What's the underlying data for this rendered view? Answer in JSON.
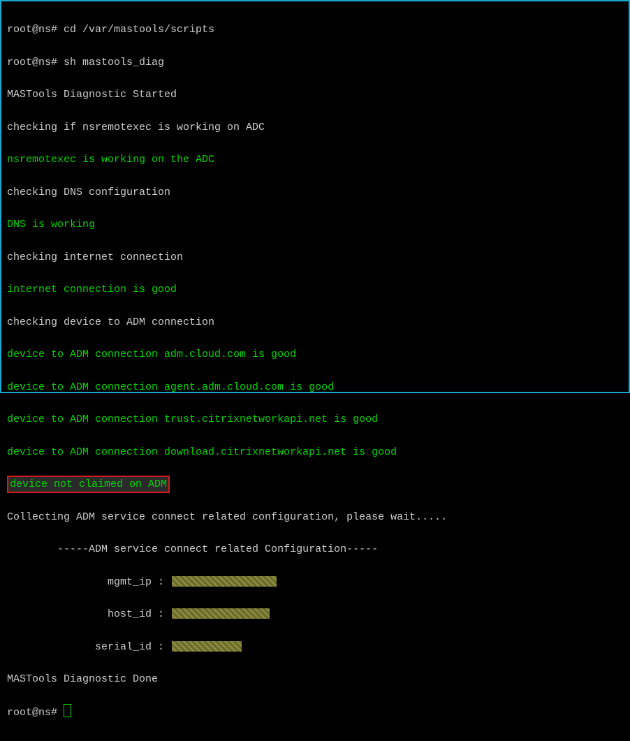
{
  "prompt1": "root@ns# ",
  "cmd1": "cd /var/mastools/scripts",
  "prompt2": "root@ns# ",
  "cmd2": "sh mastools_diag",
  "l3": "MASTools Diagnostic Started",
  "l4": "checking if nsremotexec is working on ADC",
  "l5": "nsremotexec is working on the ADC",
  "l6": "checking DNS configuration",
  "l7": "DNS is working",
  "l8": "checking internet connection",
  "l9": "internet connection is good",
  "l10": "checking device to ADM connection",
  "l11": "device to ADM connection adm.cloud.com is good",
  "l12": "device to ADM connection agent.adm.cloud.com is good",
  "l13": "device to ADM connection trust.citrixnetworkapi.net is good",
  "l14": "device to ADM connection download.citrixnetworkapi.net is good",
  "l15": "device not claimed on ADM",
  "l16": "Collecting ADM service connect related configuration, please wait.....",
  "l17": "        -----ADM service connect related Configuration-----",
  "mgmt_label": "                mgmt_ip : ",
  "host_label": "                host_id : ",
  "serial_label": "              serial_id : ",
  "l21": "MASTools Diagnostic Done",
  "prompt3": "root@ns# "
}
